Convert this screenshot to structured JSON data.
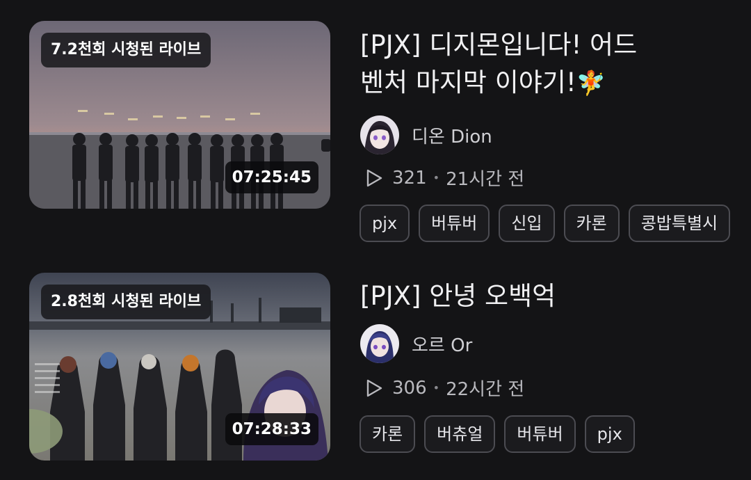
{
  "videos": [
    {
      "views_badge": "7.2천회 시청된 라이브",
      "duration": "07:25:45",
      "title_text": "[PJX] 디지몬입니다! 어드벤처 마지막 이야기!",
      "title_emoji": "🧚",
      "channel": "디온 Dion",
      "play_count": "321",
      "time_ago": "21시간 전",
      "tags": [
        "pjx",
        "버튜버",
        "신입",
        "카론",
        "콩밥특별시"
      ]
    },
    {
      "views_badge": "2.8천회 시청된 라이브",
      "duration": "07:28:33",
      "title_text": "[PJX] 안녕 오백억",
      "title_emoji": "",
      "channel": "오르 Or",
      "play_count": "306",
      "time_ago": "22시간 전",
      "tags": [
        "카론",
        "버츄얼",
        "버튜버",
        "pjx"
      ]
    }
  ],
  "icons": {
    "play": "play-icon",
    "avatar1": "avatar-dion",
    "avatar2": "avatar-or"
  },
  "colors": {
    "background": "#141416",
    "tag_border": "#4c4c52",
    "text": "#e9e9ea"
  }
}
